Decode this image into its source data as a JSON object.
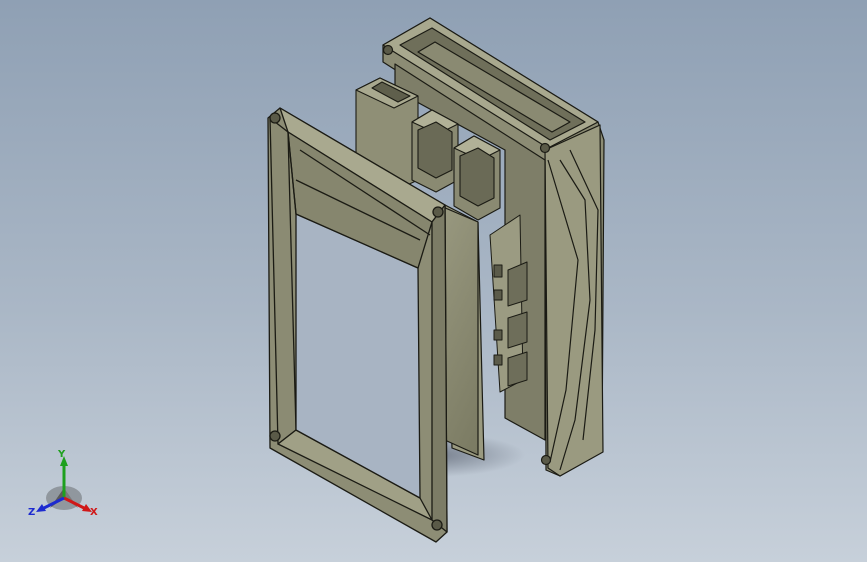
{
  "view": {
    "background_top": "#8fa0b4",
    "background_bottom": "#c7d0da",
    "part_shade": "#8a8a72",
    "part_shade_light": "#a3a38a",
    "edge_color": "#1b1b14"
  },
  "triad": {
    "x_label": "X",
    "y_label": "Y",
    "z_label": "Z",
    "x_color": "#d01818",
    "y_color": "#1ea01e",
    "z_color": "#1c2ad0"
  }
}
